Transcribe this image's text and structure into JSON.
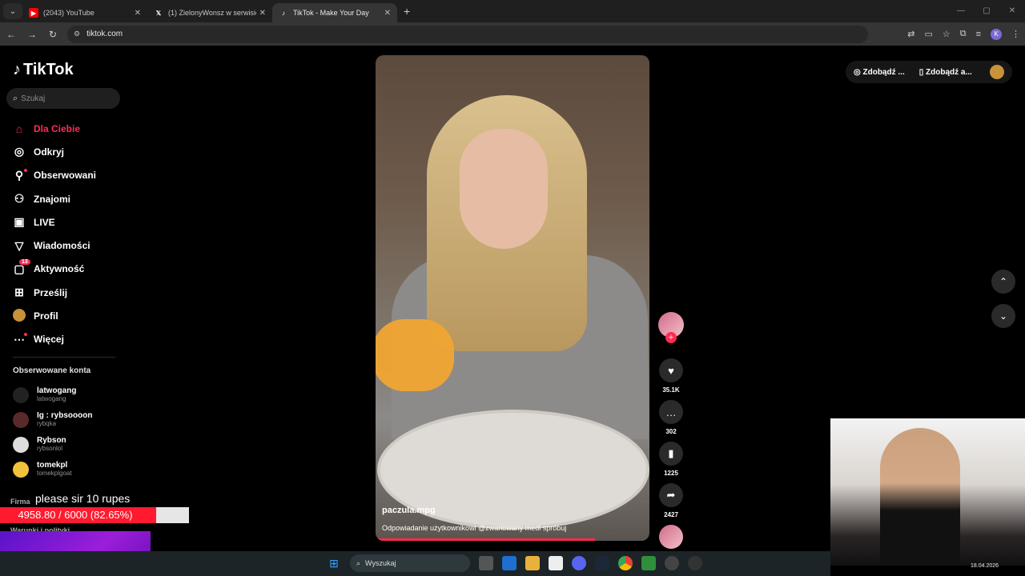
{
  "browser": {
    "tabs": [
      {
        "title": "(2043) YouTube",
        "favicon": "youtube-icon"
      },
      {
        "title": "(1) ZielonyWonsz w serwisie X",
        "favicon": "x-icon"
      },
      {
        "title": "TikTok - Make Your Day",
        "favicon": "tiktok-icon",
        "active": true
      }
    ],
    "url": "tiktok.com"
  },
  "tiktok": {
    "logo": "TikTok",
    "search_placeholder": "Szukaj",
    "nav": [
      {
        "label": "Dla Ciebie",
        "icon": "home-icon",
        "active": true
      },
      {
        "label": "Odkryj",
        "icon": "compass-icon"
      },
      {
        "label": "Obserwowani",
        "icon": "following-icon"
      },
      {
        "label": "Znajomi",
        "icon": "friends-icon"
      },
      {
        "label": "LIVE",
        "icon": "live-icon"
      },
      {
        "label": "Wiadomości",
        "icon": "messages-icon"
      },
      {
        "label": "Aktywność",
        "icon": "activity-icon",
        "badge": "13"
      },
      {
        "label": "Prześlij",
        "icon": "upload-icon"
      },
      {
        "label": "Profil",
        "icon": "profile-icon"
      },
      {
        "label": "Więcej",
        "icon": "more-icon"
      }
    ],
    "followed_header": "Obserwowane konta",
    "followed": [
      {
        "name": "latwogang",
        "handle": "latwogang"
      },
      {
        "name": "Ig : rybsoooon",
        "handle": "rybqka"
      },
      {
        "name": "Rybson",
        "handle": "rybsonlol"
      },
      {
        "name": "tomekpl",
        "handle": "tomekplgoat"
      }
    ],
    "footer_firma": "Firma",
    "footer_warunki": "Warunki i polityki",
    "video": {
      "username": "paczula.mpg",
      "description": "Odpowiadanie użytkownikowi @zwariowany medi spróbuj",
      "progress": 0.8
    },
    "actions": {
      "likes": "35.1K",
      "comments": "302",
      "saves": "1225",
      "shares": "2427"
    },
    "top_right": {
      "btn1": "Zdobądź ...",
      "btn2": "Zdobądź a..."
    }
  },
  "overlay": {
    "donate_text": "please sir 10 rupes",
    "donate_value": "4958.80 / 6000 (82.65%)",
    "donate_fraction": 0.8265
  },
  "taskbar": {
    "search": "Wyszukaj",
    "date": "18.04.2026"
  },
  "colors": {
    "accent": "#fe2c55"
  }
}
